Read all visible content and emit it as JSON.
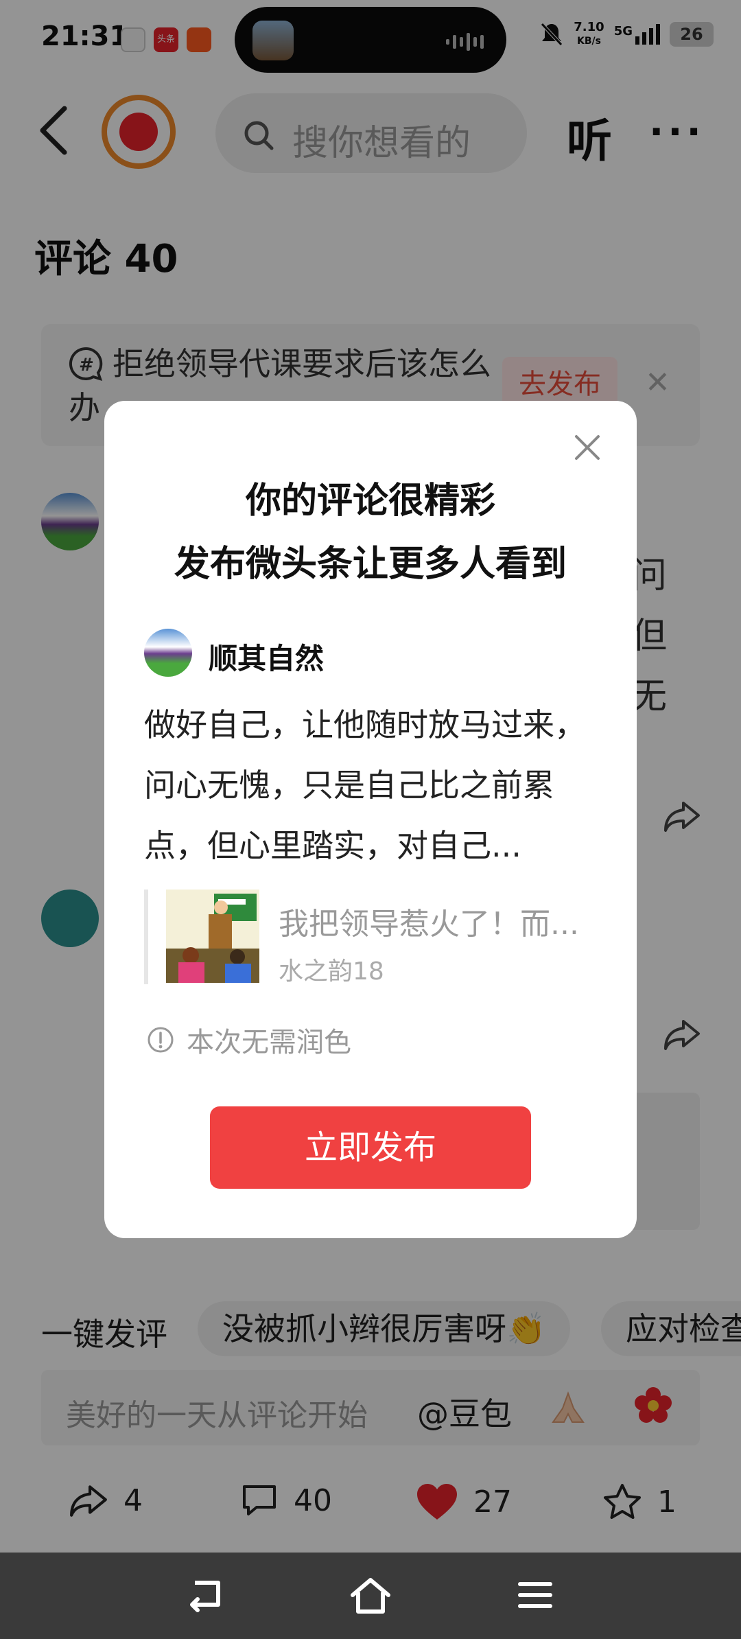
{
  "status_bar": {
    "time": "21:31",
    "apps": [
      {
        "name": "notes-app-icon",
        "color": "#f5f5f5"
      },
      {
        "name": "toutiao-app-icon",
        "label": "头条",
        "color": "#e8232b"
      },
      {
        "name": "kuaishou-app-icon",
        "color": "#ff5a1f"
      }
    ],
    "net_speed_value": "7.10",
    "net_speed_unit": "KB/s",
    "network": "5G",
    "battery": "26"
  },
  "header": {
    "search_placeholder": "搜你想看的",
    "listen_label": "听",
    "more_label": "···"
  },
  "comments": {
    "title": "评论 40",
    "topic_text": "拒绝领导代课要求后该怎么办",
    "topic_button": "去发布",
    "bg_fragments": [
      "问",
      "但",
      "无"
    ]
  },
  "quick_replies": {
    "label": "一键发评",
    "chips": [
      "没被抓小辫很厉害呀👏",
      "应对检查"
    ]
  },
  "comment_input": {
    "placeholder": "美好的一天从评论开始",
    "mention": "@豆包"
  },
  "actions": {
    "share_count": "4",
    "comment_count": "40",
    "like_count": "27",
    "favorite_count": "1"
  },
  "dialog": {
    "title_line1": "你的评论很精彩",
    "title_line2": "发布微头条让更多人看到",
    "username": "顺其自然",
    "comment_text": "做好自己，让他随时放马过来，问心无愧，只是自己比之前累点，但心里踏实，对自己...",
    "quote_title": "我把领导惹火了！而...",
    "quote_author": "水之韵18",
    "hint": "本次无需润色",
    "publish_button": "立即发布"
  },
  "colors": {
    "accent_red": "#f04141",
    "like_red": "#e8232b"
  }
}
